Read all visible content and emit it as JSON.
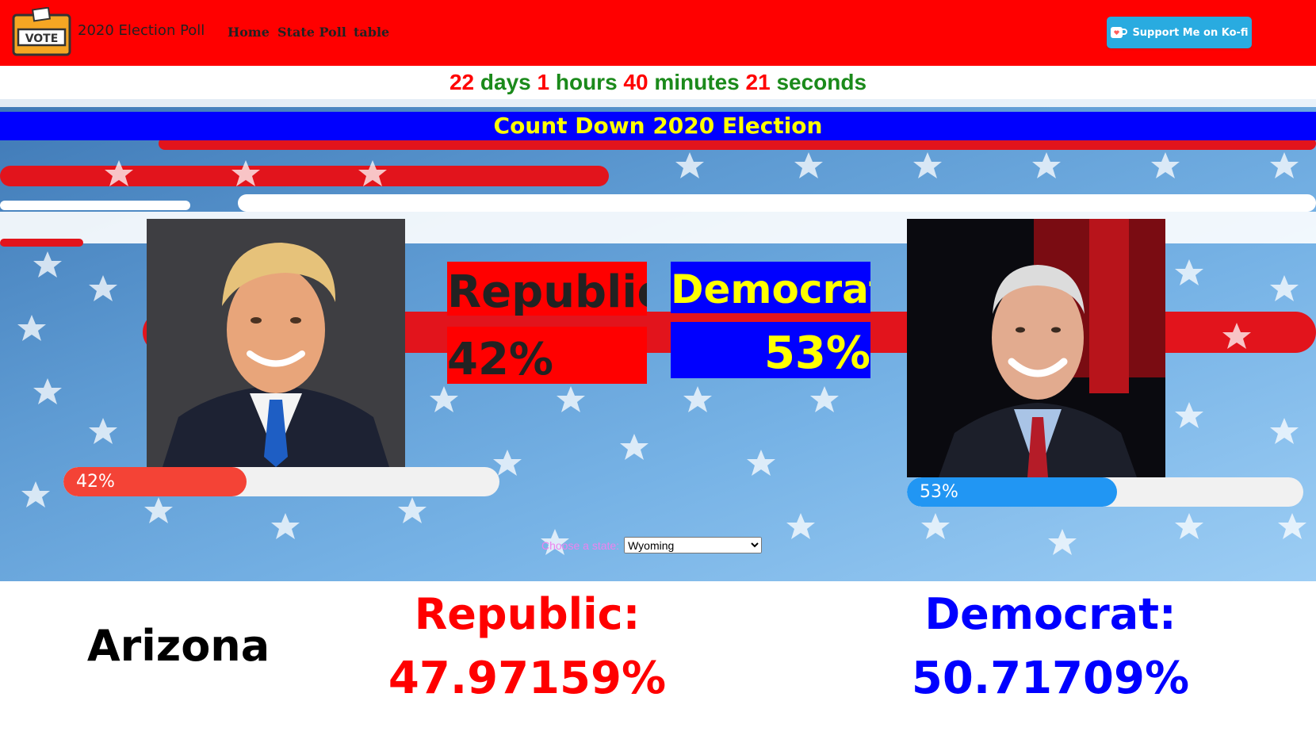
{
  "nav": {
    "brand": "2020 Election Poll",
    "links": [
      "Home",
      "State Poll",
      "table"
    ],
    "logo_text": "VOTE",
    "kofi_label": "Support Me on Ko-fi"
  },
  "countdown": {
    "days": "22",
    "days_label": "days",
    "hours": "1",
    "hours_label": "hours",
    "minutes": "40",
    "minutes_label": "minutes",
    "seconds": "21",
    "seconds_label": "seconds"
  },
  "hero": {
    "title": "Count Down 2020 Election",
    "republic": {
      "label": "Republic",
      "percent": "42%",
      "bar_label": "42%",
      "bar_value": 0.42,
      "color": "#f44336"
    },
    "democrat": {
      "label": "Democrat",
      "percent": "53%",
      "bar_label": "53%",
      "bar_value": 0.53,
      "color": "#2196f3"
    },
    "state_prompt": "Choose a state:",
    "state_selected": "Wyoming"
  },
  "results": {
    "state": "Arizona",
    "republic_label": "Republic:",
    "republic_value": "47.97159%",
    "democrat_label": "Democrat:",
    "democrat_value": "50.71709%"
  },
  "colors": {
    "nav_bg": "#ff0000",
    "title_bg": "#0000ff",
    "title_fg": "#ffff00",
    "republic": "#ff0000",
    "democrat": "#0000ff"
  }
}
